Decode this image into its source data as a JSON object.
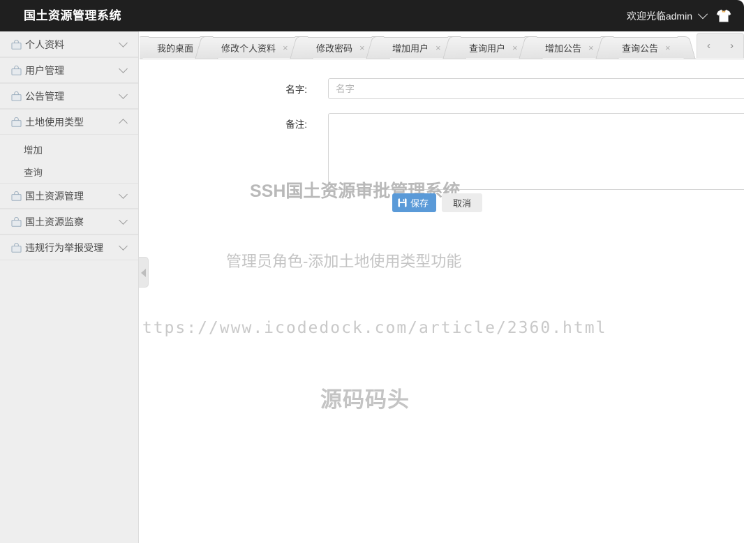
{
  "header": {
    "title": "国土资源管理系统",
    "welcome": "欢迎光临admin",
    "user_menu_icon": "chevron-down-icon",
    "avatar_icon": "tshirt-icon",
    "background": "#1f1f1f"
  },
  "sidebar": {
    "background": "#eeeeee",
    "toggle_icon": "triangle-left-icon",
    "items": [
      {
        "label": "个人资料",
        "icon": "lock-icon",
        "expanded": false,
        "caret": "chevron-down-icon",
        "children": []
      },
      {
        "label": "用户管理",
        "icon": "lock-icon",
        "expanded": false,
        "caret": "chevron-down-icon",
        "children": []
      },
      {
        "label": "公告管理",
        "icon": "lock-icon",
        "expanded": false,
        "caret": "chevron-down-icon",
        "children": []
      },
      {
        "label": "土地使用类型",
        "icon": "lock-icon",
        "expanded": true,
        "caret": "chevron-up-icon",
        "children": [
          "增加",
          "查询"
        ]
      },
      {
        "label": "国土资源管理",
        "icon": "lock-icon",
        "expanded": false,
        "caret": "chevron-down-icon",
        "children": []
      },
      {
        "label": "国土资源监察",
        "icon": "lock-icon",
        "expanded": false,
        "caret": "chevron-down-icon",
        "children": []
      },
      {
        "label": "违规行为举报受理",
        "icon": "lock-icon",
        "expanded": false,
        "caret": "chevron-down-icon",
        "children": []
      }
    ]
  },
  "tabs": {
    "items": [
      {
        "label": "我的桌面",
        "closable": false,
        "close_label": ""
      },
      {
        "label": "修改个人资料",
        "closable": true,
        "close_label": "×"
      },
      {
        "label": "修改密码",
        "closable": true,
        "close_label": "×"
      },
      {
        "label": "增加用户",
        "closable": true,
        "close_label": "×"
      },
      {
        "label": "查询用户",
        "closable": true,
        "close_label": "×"
      },
      {
        "label": "增加公告",
        "closable": true,
        "close_label": "×"
      },
      {
        "label": "查询公告",
        "closable": true,
        "close_label": "×"
      }
    ],
    "prev_label": "‹",
    "next_label": "›"
  },
  "form": {
    "name_label": "名字:",
    "name_value": "",
    "name_placeholder": "名字",
    "remark_label": "备注:",
    "remark_value": "",
    "remark_placeholder": "",
    "save_label": "保存",
    "save_icon": "save-floppy-icon",
    "save_color": "#5a9ad8",
    "cancel_label": "取消"
  },
  "watermarks": {
    "system": "SSH国土资源审批管理系统",
    "role": "管理员角色-添加土地使用类型功能",
    "url": "https://www.icodedock.com/article/2360.html",
    "brand": "源码码头"
  }
}
